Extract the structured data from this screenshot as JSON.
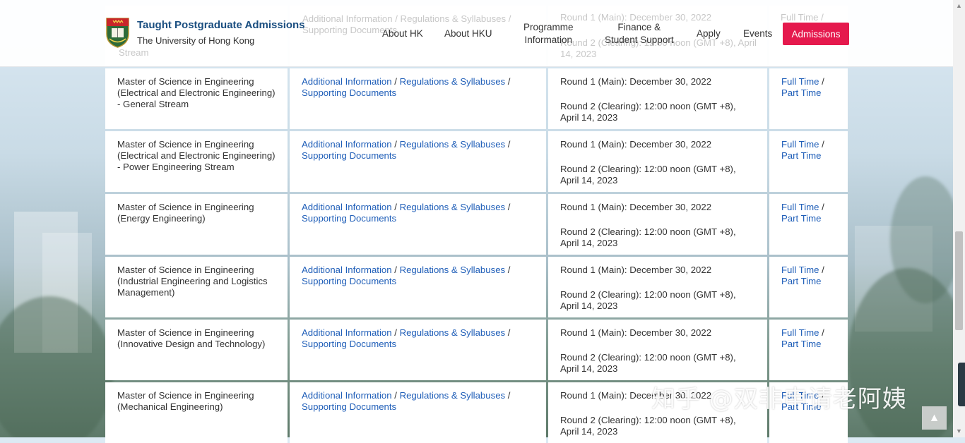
{
  "brand": {
    "title": "Taught Postgraduate Admissions",
    "subtitle": "The University of Hong Kong"
  },
  "nav": {
    "about_hk": "About HK",
    "about_hku": "About HKU",
    "programme_line1": "Programme",
    "programme_line2": "Information",
    "finance_line1": "Finance &",
    "finance_line2": "Student Support",
    "apply": "Apply",
    "events": "Events",
    "admissions": "Admissions"
  },
  "ghost": {
    "info": "Additional Information / Regulations & Syllabuses /",
    "docs": "Supporting Documents",
    "round1": "Round 1 (Main): December 30, 2022",
    "round2": "Round 2 (Clearing): 12:00 noon (GMT +8), April",
    "year": "14, 2023",
    "stream": "Stream",
    "mode": "Full Time /"
  },
  "links": {
    "additional": "Additional Information",
    "regulations": "Regulations & Syllabuses",
    "supporting": "Supporting Documents",
    "full_time": "Full Time",
    "part_time": "Part Time",
    "slash": "/"
  },
  "rows": [
    {
      "name": "Master of Science in Engineering (Electrical and Electronic Engineering) - General Stream",
      "round1": "Round 1 (Main): December 30, 2022",
      "round2": "Round 2 (Clearing): 12:00 noon (GMT +8), April 14, 2023"
    },
    {
      "name": "Master of Science in Engineering (Electrical and Electronic Engineering) - Power Engineering Stream",
      "round1": "Round 1 (Main): December 30, 2022",
      "round2": "Round 2 (Clearing): 12:00 noon (GMT +8), April 14, 2023"
    },
    {
      "name": "Master of Science in Engineering (Energy Engineering)",
      "round1": "Round 1 (Main): December 30, 2022",
      "round2": "Round 2 (Clearing): 12:00 noon (GMT +8), April 14, 2023"
    },
    {
      "name": "Master of Science in Engineering (Industrial Engineering and Logistics Management)",
      "round1": "Round 1 (Main): December 30, 2022",
      "round2": "Round 2 (Clearing): 12:00 noon (GMT +8), April 14, 2023"
    },
    {
      "name": "Master of Science in Engineering (Innovative Design and Technology)",
      "round1": "Round 1 (Main): December 30, 2022",
      "round2": "Round 2 (Clearing): 12:00 noon (GMT +8), April 14, 2023"
    },
    {
      "name": "Master of Science in Engineering (Mechanical Engineering)",
      "round1": "Round 1 (Main): December 30, 2022",
      "round2": "Round 2 (Clearing): 12:00 noon (GMT +8), April 14, 2023"
    }
  ],
  "watermark": "知乎 @双非申请老阿姨",
  "colors": {
    "brand_blue": "#1a4e80",
    "link_blue": "#1f5eb8",
    "admissions_red": "#e5194d"
  },
  "icons": {
    "logo": "hku-crest-icon",
    "back_to_top": "arrow-up-icon"
  }
}
